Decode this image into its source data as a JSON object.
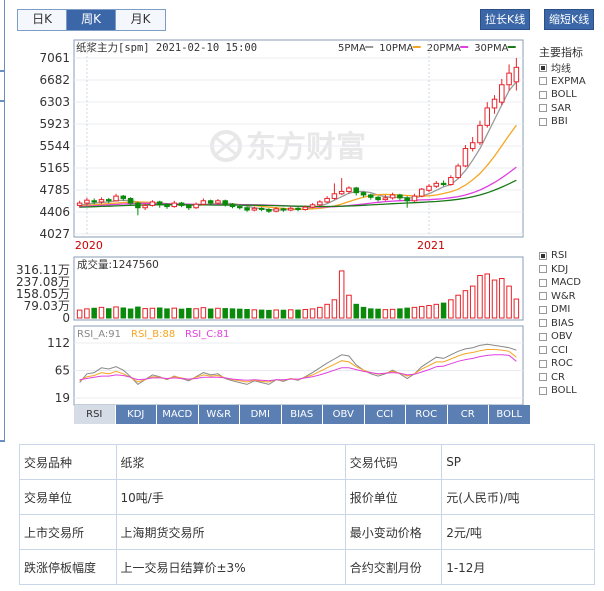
{
  "period_tabs": [
    "日K",
    "周K",
    "月K"
  ],
  "active_period": 1,
  "toolbar": {
    "lengthen": "拉长K线",
    "shorten": "缩短K线"
  },
  "chart_header": {
    "title": "纸浆主力[spm] 2021-02-10 15:00",
    "ma_legend": [
      {
        "name": "5PMA",
        "color": "#999999"
      },
      {
        "name": "10PMA",
        "color": "#f5a623"
      },
      {
        "name": "20PMA",
        "color": "#e040e0"
      },
      {
        "name": "30PMA",
        "color": "#1a7a1a"
      }
    ]
  },
  "watermark": "东方财富",
  "main_indicators": {
    "title": "主要指标",
    "items": [
      {
        "label": "均线",
        "checked": true
      },
      {
        "label": "EXPMA",
        "checked": false
      },
      {
        "label": "BOLL",
        "checked": false
      },
      {
        "label": "SAR",
        "checked": false
      },
      {
        "label": "BBI",
        "checked": false
      }
    ]
  },
  "sub_indicators": {
    "items": [
      {
        "label": "RSI",
        "checked": true
      },
      {
        "label": "KDJ",
        "checked": false
      },
      {
        "label": "MACD",
        "checked": false
      },
      {
        "label": "W&R",
        "checked": false
      },
      {
        "label": "DMI",
        "checked": false
      },
      {
        "label": "BIAS",
        "checked": false
      },
      {
        "label": "OBV",
        "checked": false
      },
      {
        "label": "CCI",
        "checked": false
      },
      {
        "label": "ROC",
        "checked": false
      },
      {
        "label": "CR",
        "checked": false
      },
      {
        "label": "BOLL",
        "checked": false
      }
    ]
  },
  "bottom_tabs": [
    "RSI",
    "KDJ",
    "MACD",
    "W&R",
    "DMI",
    "BIAS",
    "OBV",
    "CCI",
    "ROC",
    "CR",
    "BOLL"
  ],
  "active_bottom_tab": 0,
  "chart_data": {
    "type": "candlestick",
    "price_axis": {
      "ticks": [
        "7061",
        "6682",
        "6303",
        "5923",
        "5544",
        "5165",
        "4785",
        "4406",
        "4027"
      ],
      "min": 4027,
      "max": 7061
    },
    "x_labels": [
      {
        "label": "2020",
        "index": 1
      },
      {
        "label": "2021",
        "index": 48
      }
    ],
    "candles": [
      {
        "o": 4520,
        "c": 4560,
        "h": 4600,
        "l": 4480
      },
      {
        "o": 4560,
        "c": 4610,
        "h": 4650,
        "l": 4520
      },
      {
        "o": 4600,
        "c": 4580,
        "h": 4640,
        "l": 4540
      },
      {
        "o": 4580,
        "c": 4620,
        "h": 4660,
        "l": 4550
      },
      {
        "o": 4620,
        "c": 4600,
        "h": 4650,
        "l": 4560
      },
      {
        "o": 4600,
        "c": 4680,
        "h": 4720,
        "l": 4590
      },
      {
        "o": 4680,
        "c": 4640,
        "h": 4700,
        "l": 4600
      },
      {
        "o": 4640,
        "c": 4560,
        "h": 4660,
        "l": 4530
      },
      {
        "o": 4560,
        "c": 4480,
        "h": 4580,
        "l": 4350
      },
      {
        "o": 4480,
        "c": 4520,
        "h": 4550,
        "l": 4440
      },
      {
        "o": 4520,
        "c": 4580,
        "h": 4610,
        "l": 4500
      },
      {
        "o": 4580,
        "c": 4540,
        "h": 4600,
        "l": 4480
      },
      {
        "o": 4540,
        "c": 4500,
        "h": 4560,
        "l": 4460
      },
      {
        "o": 4500,
        "c": 4560,
        "h": 4600,
        "l": 4480
      },
      {
        "o": 4560,
        "c": 4520,
        "h": 4580,
        "l": 4490
      },
      {
        "o": 4520,
        "c": 4480,
        "h": 4540,
        "l": 4440
      },
      {
        "o": 4480,
        "c": 4540,
        "h": 4570,
        "l": 4460
      },
      {
        "o": 4540,
        "c": 4600,
        "h": 4640,
        "l": 4520
      },
      {
        "o": 4600,
        "c": 4560,
        "h": 4620,
        "l": 4530
      },
      {
        "o": 4560,
        "c": 4600,
        "h": 4630,
        "l": 4540
      },
      {
        "o": 4600,
        "c": 4540,
        "h": 4620,
        "l": 4500
      },
      {
        "o": 4540,
        "c": 4500,
        "h": 4560,
        "l": 4470
      },
      {
        "o": 4500,
        "c": 4480,
        "h": 4520,
        "l": 4450
      },
      {
        "o": 4480,
        "c": 4440,
        "h": 4500,
        "l": 4410
      },
      {
        "o": 4440,
        "c": 4470,
        "h": 4500,
        "l": 4420
      },
      {
        "o": 4470,
        "c": 4450,
        "h": 4490,
        "l": 4420
      },
      {
        "o": 4450,
        "c": 4420,
        "h": 4470,
        "l": 4390
      },
      {
        "o": 4420,
        "c": 4460,
        "h": 4490,
        "l": 4400
      },
      {
        "o": 4460,
        "c": 4440,
        "h": 4480,
        "l": 4410
      },
      {
        "o": 4440,
        "c": 4470,
        "h": 4500,
        "l": 4420
      },
      {
        "o": 4470,
        "c": 4450,
        "h": 4490,
        "l": 4420
      },
      {
        "o": 4450,
        "c": 4490,
        "h": 4520,
        "l": 4430
      },
      {
        "o": 4490,
        "c": 4530,
        "h": 4560,
        "l": 4470
      },
      {
        "o": 4530,
        "c": 4580,
        "h": 4610,
        "l": 4510
      },
      {
        "o": 4580,
        "c": 4640,
        "h": 4680,
        "l": 4560
      },
      {
        "o": 4640,
        "c": 4720,
        "h": 4900,
        "l": 4620
      },
      {
        "o": 4720,
        "c": 4760,
        "h": 4990,
        "l": 4700
      },
      {
        "o": 4760,
        "c": 4820,
        "h": 4850,
        "l": 4720
      },
      {
        "o": 4820,
        "c": 4740,
        "h": 4840,
        "l": 4690
      },
      {
        "o": 4740,
        "c": 4700,
        "h": 4760,
        "l": 4660
      },
      {
        "o": 4700,
        "c": 4660,
        "h": 4720,
        "l": 4620
      },
      {
        "o": 4660,
        "c": 4620,
        "h": 4680,
        "l": 4590
      },
      {
        "o": 4620,
        "c": 4650,
        "h": 4700,
        "l": 4600
      },
      {
        "o": 4650,
        "c": 4700,
        "h": 4740,
        "l": 4620
      },
      {
        "o": 4700,
        "c": 4650,
        "h": 4720,
        "l": 4610
      },
      {
        "o": 4650,
        "c": 4600,
        "h": 4680,
        "l": 4480
      },
      {
        "o": 4600,
        "c": 4680,
        "h": 4720,
        "l": 4580
      },
      {
        "o": 4680,
        "c": 4800,
        "h": 4820,
        "l": 4660
      },
      {
        "o": 4780,
        "c": 4850,
        "h": 4890,
        "l": 4750
      },
      {
        "o": 4850,
        "c": 4900,
        "h": 4940,
        "l": 4820
      },
      {
        "o": 4900,
        "c": 4880,
        "h": 4950,
        "l": 4850
      },
      {
        "o": 4880,
        "c": 5000,
        "h": 5040,
        "l": 4860
      },
      {
        "o": 5000,
        "c": 5200,
        "h": 5240,
        "l": 4980
      },
      {
        "o": 5200,
        "c": 5500,
        "h": 5560,
        "l": 5180
      },
      {
        "o": 5500,
        "c": 5600,
        "h": 5700,
        "l": 5450
      },
      {
        "o": 5600,
        "c": 5900,
        "h": 5980,
        "l": 5560
      },
      {
        "o": 5900,
        "c": 6200,
        "h": 6300,
        "l": 5860
      },
      {
        "o": 6200,
        "c": 6350,
        "h": 6420,
        "l": 6100
      },
      {
        "o": 6300,
        "c": 6600,
        "h": 6700,
        "l": 6250
      },
      {
        "o": 6600,
        "c": 6800,
        "h": 6950,
        "l": 6500
      },
      {
        "o": 6650,
        "c": 6900,
        "h": 7061,
        "l": 6500
      }
    ],
    "ma": {
      "5PMA": [
        4520,
        4540,
        4560,
        4570,
        4580,
        4600,
        4610,
        4600,
        4580,
        4560,
        4540,
        4530,
        4530,
        4530,
        4540,
        4530,
        4520,
        4530,
        4540,
        4550,
        4560,
        4550,
        4530,
        4510,
        4480,
        4460,
        4450,
        4440,
        4440,
        4450,
        4450,
        4460,
        4480,
        4510,
        4550,
        4610,
        4670,
        4730,
        4760,
        4760,
        4740,
        4700,
        4670,
        4660,
        4660,
        4650,
        4650,
        4680,
        4720,
        4780,
        4840,
        4880,
        4980,
        5120,
        5300,
        5500,
        5750,
        6000,
        6250,
        6500,
        6650
      ],
      "10PMA": [
        4510,
        4520,
        4530,
        4540,
        4550,
        4560,
        4570,
        4575,
        4580,
        4575,
        4570,
        4560,
        4550,
        4545,
        4540,
        4535,
        4530,
        4528,
        4528,
        4530,
        4535,
        4538,
        4535,
        4528,
        4518,
        4505,
        4490,
        4478,
        4468,
        4460,
        4455,
        4455,
        4460,
        4470,
        4485,
        4510,
        4545,
        4585,
        4625,
        4660,
        4690,
        4705,
        4710,
        4705,
        4700,
        4690,
        4682,
        4680,
        4685,
        4700,
        4725,
        4755,
        4800,
        4870,
        4960,
        5070,
        5210,
        5370,
        5550,
        5730,
        5900
      ],
      "20PMA": [
        4500,
        4505,
        4512,
        4520,
        4528,
        4536,
        4544,
        4550,
        4554,
        4556,
        4556,
        4554,
        4550,
        4547,
        4544,
        4541,
        4538,
        4536,
        4534,
        4533,
        4533,
        4534,
        4534,
        4533,
        4531,
        4528,
        4524,
        4520,
        4514,
        4508,
        4502,
        4497,
        4493,
        4491,
        4492,
        4497,
        4506,
        4518,
        4531,
        4545,
        4560,
        4573,
        4585,
        4594,
        4601,
        4606,
        4610,
        4614,
        4619,
        4627,
        4638,
        4652,
        4672,
        4700,
        4738,
        4785,
        4845,
        4915,
        4995,
        5085,
        5180
      ],
      "30PMA": [
        4490,
        4493,
        4497,
        4502,
        4507,
        4512,
        4517,
        4522,
        4526,
        4529,
        4531,
        4532,
        4532,
        4532,
        4531,
        4530,
        4529,
        4528,
        4527,
        4526,
        4526,
        4526,
        4525,
        4524,
        4523,
        4521,
        4519,
        4516,
        4513,
        4510,
        4507,
        4504,
        4502,
        4501,
        4501,
        4503,
        4506,
        4510,
        4515,
        4521,
        4528,
        4535,
        4542,
        4549,
        4555,
        4561,
        4567,
        4573,
        4580,
        4588,
        4598,
        4610,
        4625,
        4645,
        4670,
        4700,
        4738,
        4783,
        4835,
        4893,
        4955
      ]
    },
    "volume": {
      "label": "成交量:1247560",
      "ticks": [
        "316.11万",
        "237.08万",
        "158.05万",
        "79.03万",
        "0"
      ],
      "max": 3161100,
      "values": [
        520000,
        600000,
        640000,
        700000,
        610000,
        730000,
        660000,
        590000,
        720000,
        620000,
        640000,
        660000,
        600000,
        650000,
        580000,
        630000,
        610000,
        680000,
        590000,
        640000,
        620000,
        600000,
        580000,
        560000,
        540000,
        520000,
        500000,
        530000,
        510000,
        540000,
        520000,
        560000,
        600000,
        700000,
        900000,
        1200000,
        3100000,
        1500000,
        900000,
        700000,
        600000,
        580000,
        550000,
        570000,
        600000,
        650000,
        700000,
        760000,
        820000,
        900000,
        980000,
        1200000,
        1500000,
        1800000,
        2100000,
        2800000,
        2900000,
        2500000,
        2600000,
        2100000,
        1247560
      ]
    },
    "rsi": {
      "label_a": "RSI_A:91",
      "label_b": "RSI_B:88",
      "label_c": "RSI_C:81",
      "color_a": "#888888",
      "color_b": "#f5a623",
      "color_c": "#e040e0",
      "ticks": [
        "112",
        "65",
        "19"
      ],
      "min": 19,
      "max": 112,
      "a": [
        45,
        60,
        62,
        70,
        68,
        72,
        66,
        55,
        42,
        50,
        58,
        55,
        50,
        56,
        52,
        48,
        55,
        62,
        58,
        60,
        52,
        48,
        45,
        42,
        48,
        45,
        42,
        50,
        47,
        52,
        49,
        55,
        62,
        70,
        78,
        85,
        92,
        90,
        75,
        66,
        60,
        56,
        60,
        66,
        60,
        52,
        60,
        72,
        80,
        88,
        86,
        92,
        98,
        102,
        104,
        108,
        110,
        108,
        106,
        104,
        100
      ],
      "b": [
        48,
        55,
        57,
        62,
        60,
        64,
        60,
        54,
        46,
        50,
        55,
        54,
        51,
        55,
        53,
        50,
        54,
        58,
        56,
        57,
        53,
        50,
        48,
        46,
        49,
        47,
        46,
        50,
        49,
        52,
        50,
        54,
        58,
        64,
        70,
        76,
        82,
        80,
        72,
        66,
        62,
        59,
        61,
        64,
        61,
        56,
        60,
        68,
        74,
        80,
        80,
        85,
        90,
        94,
        96,
        99,
        101,
        101,
        100,
        98,
        88
      ],
      "c": [
        50,
        52,
        54,
        56,
        56,
        58,
        57,
        54,
        50,
        51,
        53,
        53,
        52,
        53,
        52,
        51,
        52,
        54,
        54,
        54,
        53,
        51,
        50,
        49,
        50,
        49,
        48,
        50,
        50,
        51,
        51,
        53,
        55,
        58,
        62,
        66,
        70,
        70,
        67,
        64,
        62,
        60,
        61,
        62,
        61,
        58,
        59,
        63,
        67,
        72,
        73,
        77,
        81,
        84,
        86,
        89,
        91,
        92,
        92,
        91,
        81
      ]
    }
  },
  "info_table": [
    {
      "k1": "交易品种",
      "v1": "纸浆",
      "k2": "交易代码",
      "v2": "SP"
    },
    {
      "k1": "交易单位",
      "v1": "10吨/手",
      "k2": "报价单位",
      "v2": "元(人民币)/吨"
    },
    {
      "k1": "上市交易所",
      "v1": "上海期货交易所",
      "k2": "最小变动价格",
      "v2": "2元/吨"
    },
    {
      "k1": "跌涨停板幅度",
      "v1": "上一交易日结算价±3%",
      "k2": "合约交割月份",
      "v2": "1-12月"
    }
  ],
  "colors": {
    "up": "#e8222a",
    "down": "#0a8a0a",
    "frame": "#8a9bb5",
    "grid": "#e8ecf2",
    "axis_date": "#cc0000"
  }
}
